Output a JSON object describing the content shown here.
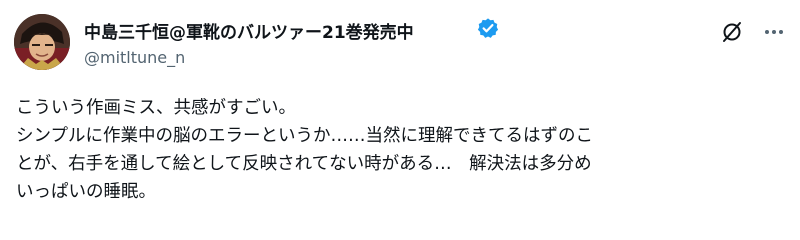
{
  "author": {
    "display_name": "中島三千恒@軍靴のバルツァー21巻発売中",
    "handle": "@mitltune_n",
    "verified": true,
    "avatar_icon": "user-avatar"
  },
  "header_actions": {
    "grok_icon": "slash-circle-icon",
    "more_icon": "more-options-icon"
  },
  "tweet": {
    "lines": [
      "こういう作画ミス、共感がすごい。",
      "シンプルに作業中の脳のエラーというか……当然に理解できてるはずのこ",
      "とが、右手を通して絵として反映されてない時がある…　解決法は多分め",
      "いっぱいの睡眠。"
    ]
  },
  "colors": {
    "text": "#0f1419",
    "secondary_text": "#536471",
    "verified_blue": "#1d9bf0",
    "background": "#ffffff"
  }
}
